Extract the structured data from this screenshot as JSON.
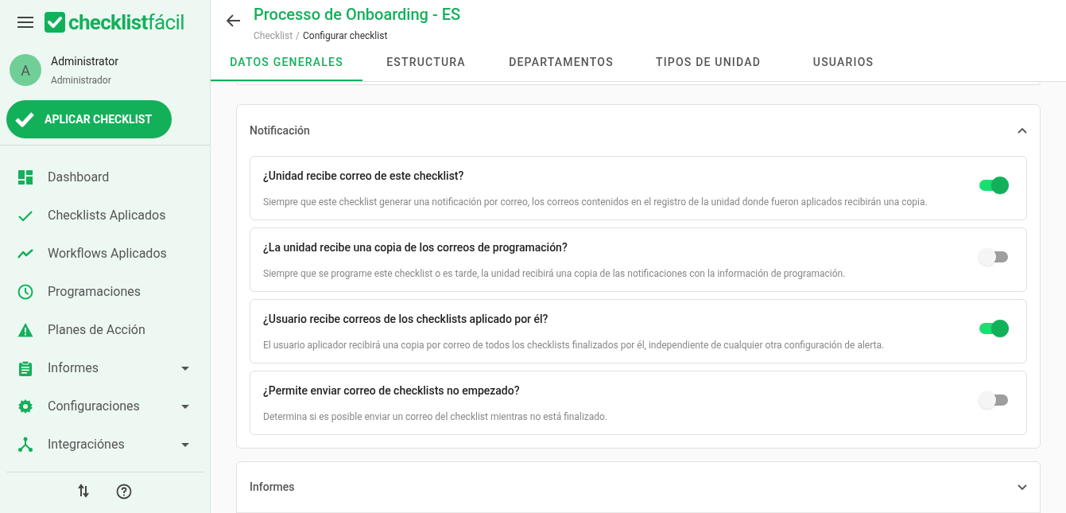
{
  "logo": "**checklist**fácil",
  "user": {
    "initial": "A",
    "name": "Administrator",
    "role": "Administrador"
  },
  "apply_button": "APLICAR CHECKLIST",
  "sidebar": {
    "items": [
      {
        "label": "Dashboard",
        "expandable": false
      },
      {
        "label": "Checklists Aplicados",
        "expandable": false
      },
      {
        "label": "Workflows Aplicados",
        "expandable": false
      },
      {
        "label": "Programaciones",
        "expandable": false
      },
      {
        "label": "Planes de Acción",
        "expandable": false
      },
      {
        "label": "Informes",
        "expandable": true
      },
      {
        "label": "Configuraciones",
        "expandable": true
      },
      {
        "label": "Integraciónes",
        "expandable": true
      }
    ]
  },
  "header": {
    "title": "Processo de Onboarding - ES",
    "breadcrumb": [
      "Checklist",
      "Configurar checklist"
    ],
    "breadcrumb_separator": "/"
  },
  "tabs": [
    {
      "label": "DATOS GENERALES",
      "selected": true
    },
    {
      "label": "ESTRUCTURA",
      "selected": false
    },
    {
      "label": "DEPARTAMENTOS",
      "selected": false
    },
    {
      "label": "TIPOS DE UNIDAD",
      "selected": false
    },
    {
      "label": "USUARIOS",
      "selected": false
    }
  ],
  "sections": [
    {
      "title": "Notificación",
      "expanded": true,
      "settings": [
        {
          "question": "¿Unidad recibe correo de este checklist?",
          "description": "Siempre que este checklist generar una notificación por correo, los correos contenidos en el registro de la unidad donde fueron aplicados recibirán una copia.",
          "on": true
        },
        {
          "question": "¿La unidad recibe una copia de los correos de programación?",
          "description": "Siempre que se programe este checklist o es tarde, la unidad recibirá una copia de las notificaciones con la información de programación.",
          "on": false
        },
        {
          "question": "¿Usuario recibe correos de los checklists aplicado por él?",
          "description": "El usuario aplicador recibirá una copia por correo de todos los checklists finalizados por él, independiente de cualquier otra configuración de alerta.",
          "on": true
        },
        {
          "question": "¿Permite enviar correo de checklists no empezado?",
          "description": "Determina si es posible enviar un correo del checklist mientras no está finalizado.",
          "on": false
        }
      ]
    },
    {
      "title": "Informes",
      "expanded": false
    }
  ]
}
